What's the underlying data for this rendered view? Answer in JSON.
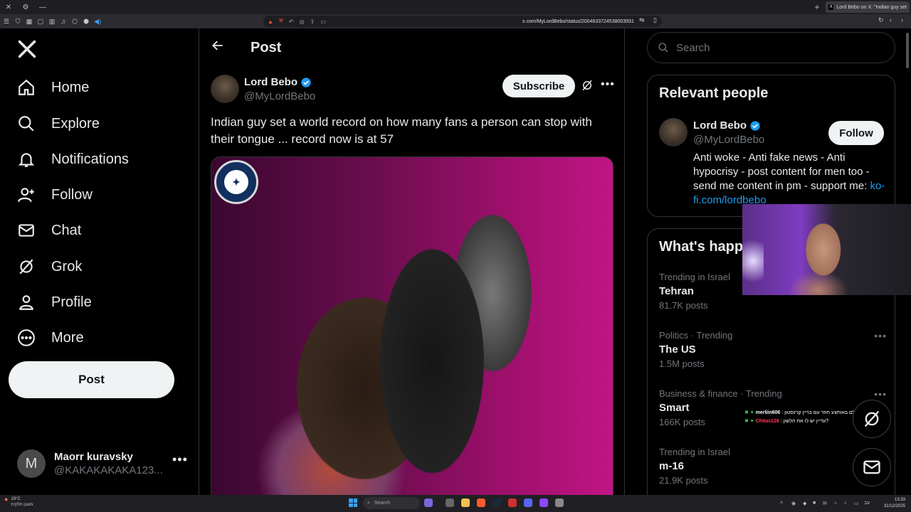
{
  "browser": {
    "tab_title": "Lord Bebo on X: \"Indian guy set",
    "url": "x.com/MyLordBebo/status/2004633724538003931"
  },
  "nav": {
    "items": [
      {
        "label": "Home",
        "icon": "home-icon"
      },
      {
        "label": "Explore",
        "icon": "search-icon"
      },
      {
        "label": "Notifications",
        "icon": "bell-icon"
      },
      {
        "label": "Follow",
        "icon": "person-plus-icon"
      },
      {
        "label": "Chat",
        "icon": "envelope-icon"
      },
      {
        "label": "Grok",
        "icon": "grok-icon"
      },
      {
        "label": "Profile",
        "icon": "person-icon"
      },
      {
        "label": "More",
        "icon": "more-circle-icon"
      }
    ],
    "post_label": "Post"
  },
  "account": {
    "initial": "M",
    "name": "Maorr kuravsky",
    "handle": "@KAKAKAKAKA123..."
  },
  "header": {
    "title": "Post"
  },
  "tweet": {
    "author_name": "Lord Bebo",
    "author_handle": "@MyLordBebo",
    "subscribe_label": "Subscribe",
    "text": "Indian guy set a world record on how many fans a person can stop with their tongue ... record now is at 57",
    "media_badge": "GUINNESS WORLD RECORDS"
  },
  "search": {
    "placeholder": "Search"
  },
  "relevant": {
    "title": "Relevant people",
    "name": "Lord Bebo",
    "handle": "@MyLordBebo",
    "follow_label": "Follow",
    "bio": "Anti woke - Anti fake news - Anti hypocrisy - post content for men too - send me content in pm - support me:",
    "bio_link": "ko-fi.com/lordbebo"
  },
  "happening": {
    "title": "What's happ",
    "trends": [
      {
        "context": "Trending in Israel",
        "topic": "Tehran",
        "count": "81.7K posts"
      },
      {
        "context": "Politics · Trending",
        "topic": "The US",
        "count": "1.5M posts"
      },
      {
        "context": "Business & finance · Trending",
        "topic": "Smart",
        "count": "166K posts"
      },
      {
        "context": "Trending in Israel",
        "topic": "m-16",
        "count": "21.9K posts"
      }
    ]
  },
  "chat_overlay": {
    "messages": [
      {
        "user": "merliin606",
        "text": ": אחד שעלקולם באותצע חוזר עם בריין קרנסטון???"
      },
      {
        "user": "Chitas126",
        "text": ": עדיין יש לו את הלשון?"
      }
    ]
  },
  "taskbar": {
    "weather_temp": "19°C",
    "weather_desc": "מעונן חלקית",
    "search_placeholder": "Search",
    "time": "13:33",
    "date": "31/12/2025"
  },
  "colors": {
    "accent": "#1d9bf0",
    "background": "#000000",
    "border": "#2f3336",
    "muted": "#71767b"
  }
}
